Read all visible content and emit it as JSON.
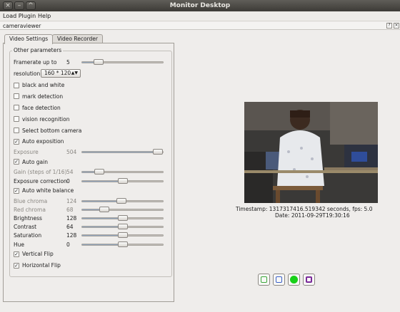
{
  "window": {
    "title": "Monitor Desktop"
  },
  "menu": {
    "load_plugin": "Load Plugin",
    "help": "Help"
  },
  "plugin": {
    "name": "cameraviewer"
  },
  "tabs": {
    "video_settings": "Video Settings",
    "video_recorder": "Video Recorder"
  },
  "group": {
    "title": "Other parameters"
  },
  "params": {
    "framerate_label": "Framerate up to",
    "framerate_value": "5",
    "framerate_fraction": 0.2,
    "resolution_label": "resolution",
    "resolution_value": "160 * 120",
    "black_white": "black and white",
    "mark_detection": "mark detection",
    "face_detection": "face detection",
    "vision_recognition": "vision recognition",
    "bottom_camera": "Select bottom camera",
    "auto_exposition": "Auto exposition",
    "exposure_label": "Exposure",
    "exposure_value": "504",
    "exposure_fraction": 0.99,
    "auto_gain": "Auto gain",
    "gain_label": "Gain (steps of 1/16)",
    "gain_value": "54",
    "gain_fraction": 0.21,
    "exposure_correction_label": "Exposure correction",
    "exposure_correction_value": "0",
    "exposure_correction_fraction": 0.5,
    "auto_white_balance": "Auto white balance",
    "blue_chroma_label": "Blue chroma",
    "blue_chroma_value": "124",
    "blue_chroma_fraction": 0.49,
    "red_chroma_label": "Red chroma",
    "red_chroma_value": "68",
    "red_chroma_fraction": 0.27,
    "brightness_label": "Brightness",
    "brightness_value": "128",
    "brightness_fraction": 0.5,
    "contrast_label": "Contrast",
    "contrast_value": "64",
    "contrast_fraction": 0.5,
    "saturation_label": "Saturation",
    "saturation_value": "128",
    "saturation_fraction": 0.5,
    "hue_label": "Hue",
    "hue_value": "0",
    "hue_fraction": 0.5,
    "vertical_flip": "Vertical Flip",
    "horizontal_flip": "Horizontal Flip"
  },
  "checks": {
    "black_white": false,
    "mark_detection": false,
    "face_detection": false,
    "vision_recognition": false,
    "bottom_camera": false,
    "auto_exposition": true,
    "auto_gain": true,
    "auto_white_balance": true,
    "vertical_flip": true,
    "horizontal_flip": true
  },
  "video": {
    "timestamp": "Timestamp: 1317317416.519342 seconds,  fps: 5.0",
    "date": "Date: 2011-09-29T19:30:16"
  },
  "controls": {
    "colors": [
      "#3aa63a",
      "#3a5fc8",
      "#18d018",
      "#7a2a9a"
    ]
  }
}
